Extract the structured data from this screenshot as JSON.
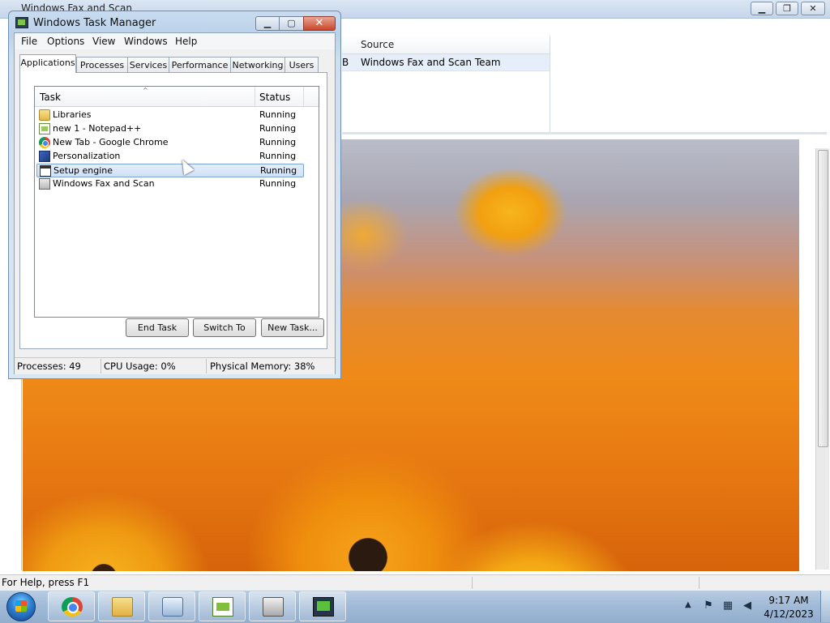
{
  "fax_window": {
    "title": "Windows Fax and Scan",
    "controls": {
      "minimize": "▁",
      "maximize": "❐",
      "close": "✕"
    },
    "list": {
      "column_source": "Source",
      "row_prefix": "B",
      "row_source": "Windows Fax and Scan Team"
    },
    "status": "For Help, press F1"
  },
  "task_manager": {
    "title": "Windows Task Manager",
    "controls": {
      "minimize": "▁",
      "maximize": "▢",
      "close": "✕"
    },
    "menu": [
      "File",
      "Options",
      "View",
      "Windows",
      "Help"
    ],
    "tabs": [
      "Applications",
      "Processes",
      "Services",
      "Performance",
      "Networking",
      "Users"
    ],
    "active_tab": "Applications",
    "columns": {
      "task": "Task",
      "status": "Status"
    },
    "sort_indicator": "^",
    "rows": [
      {
        "task": "Libraries",
        "status": "Running",
        "icon": "folder-icon"
      },
      {
        "task": "new 1 - Notepad++",
        "status": "Running",
        "icon": "notepad-plus-plus-icon"
      },
      {
        "task": "New Tab - Google Chrome",
        "status": "Running",
        "icon": "chrome-icon"
      },
      {
        "task": "Personalization",
        "status": "Running",
        "icon": "personalization-icon"
      },
      {
        "task": "Setup engine",
        "status": "Running",
        "icon": "setup-window-icon",
        "selected": true
      },
      {
        "task": "Windows Fax and Scan",
        "status": "Running",
        "icon": "fax-icon"
      }
    ],
    "buttons": {
      "end_task": "End Task",
      "switch_to": "Switch To",
      "new_task": "New Task..."
    },
    "statusbar": {
      "processes": "Processes: 49",
      "cpu": "CPU Usage: 0%",
      "memory": "Physical Memory: 38%"
    }
  },
  "taskbar": {
    "pinned": [
      "chrome-icon",
      "windows-explorer-icon",
      "control-panel-icon",
      "notepad-plus-plus-icon",
      "fax-scan-icon",
      "task-manager-icon"
    ],
    "tray": {
      "chevron": "▲",
      "time": "9:17 AM",
      "date": "4/12/2023"
    }
  }
}
